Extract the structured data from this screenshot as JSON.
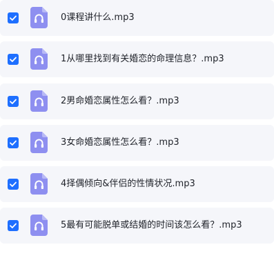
{
  "files": [
    {
      "name": "0课程讲什么.mp3",
      "checked": true,
      "icon": "headphones-icon"
    },
    {
      "name": "1从哪里找到有关婚恋的命理信息？.mp3",
      "checked": true,
      "icon": "headphones-icon"
    },
    {
      "name": "2男命婚恋属性怎么看？.mp3",
      "checked": true,
      "icon": "headphones-icon"
    },
    {
      "name": "3女命婚恋属性怎么看？.mp3",
      "checked": true,
      "icon": "headphones-icon"
    },
    {
      "name": "4择偶倾向&伴侣的性情状况.mp3",
      "checked": true,
      "icon": "headphones-icon"
    },
    {
      "name": "5最有可能脱单或结婚的时间该怎么看？.mp3",
      "checked": true,
      "icon": "headphones-icon"
    }
  ],
  "colors": {
    "row_background": "#f5f6fa",
    "checkbox": "#1e6fff",
    "file_icon": "#8e8ff0",
    "text": "#1f2229"
  }
}
